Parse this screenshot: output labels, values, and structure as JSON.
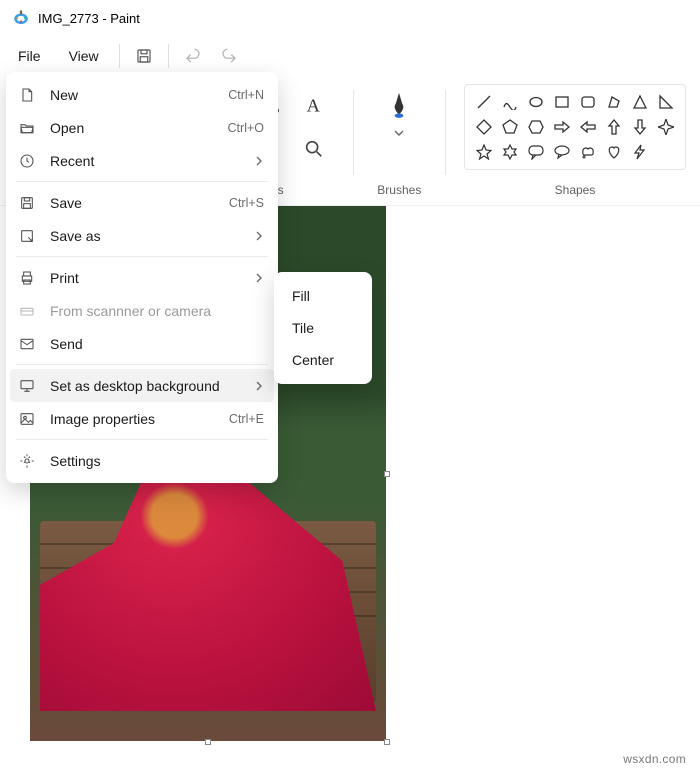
{
  "title": "IMG_2773 - Paint",
  "menubar": {
    "file": "File",
    "view": "View"
  },
  "ribbon": {
    "tools_label": "Tools",
    "brushes_label": "Brushes",
    "shapes_label": "Shapes"
  },
  "file_menu": {
    "new": "New",
    "new_accel": "Ctrl+N",
    "open": "Open",
    "open_accel": "Ctrl+O",
    "recent": "Recent",
    "save": "Save",
    "save_accel": "Ctrl+S",
    "save_as": "Save as",
    "print": "Print",
    "scanner": "From scannner or camera",
    "send": "Send",
    "set_bg": "Set as desktop background",
    "img_props": "Image properties",
    "img_props_accel": "Ctrl+E",
    "settings": "Settings"
  },
  "submenu": {
    "fill": "Fill",
    "tile": "Tile",
    "center": "Center"
  },
  "watermark": "wsxdn.com"
}
